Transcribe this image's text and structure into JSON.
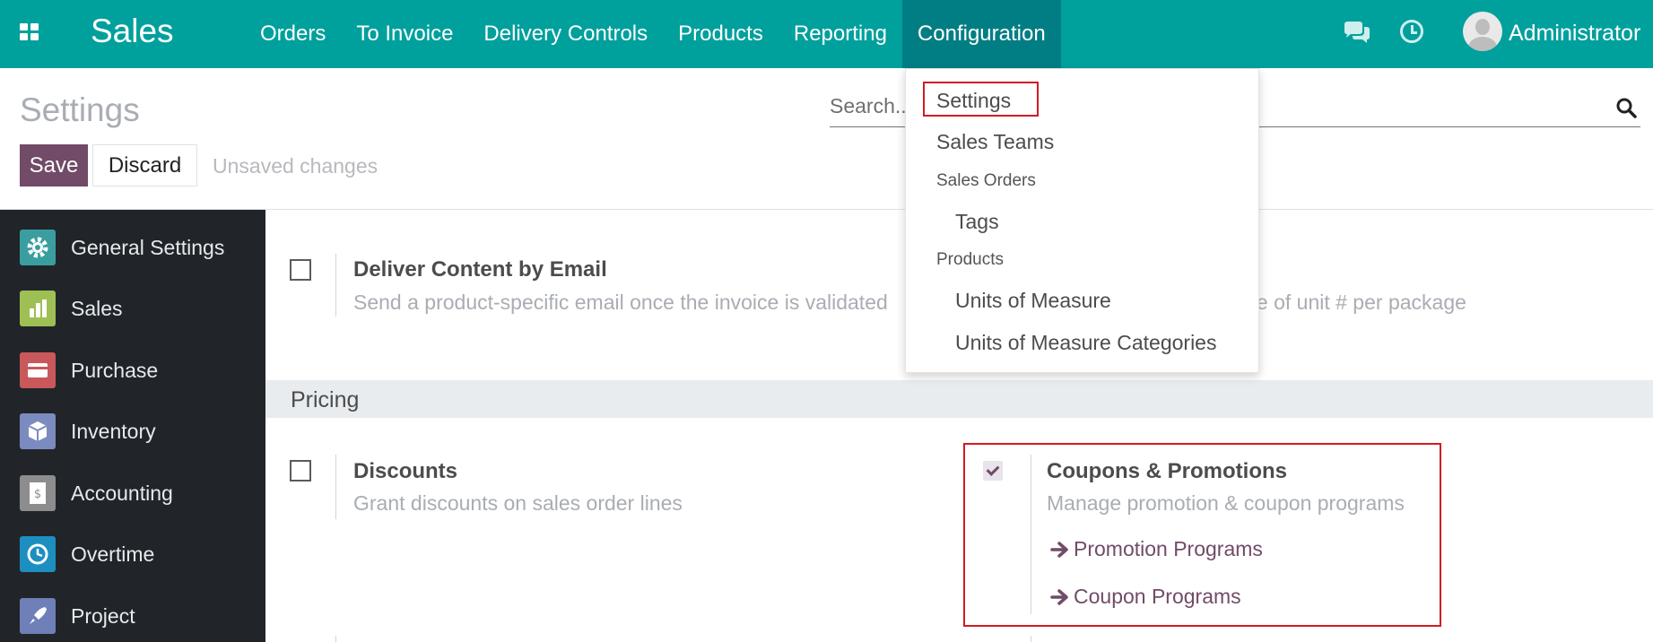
{
  "app": {
    "name": "Sales",
    "user": "Administrator"
  },
  "nav": {
    "menu": [
      {
        "label": "Orders"
      },
      {
        "label": "To Invoice"
      },
      {
        "label": "Delivery Controls"
      },
      {
        "label": "Products"
      },
      {
        "label": "Reporting"
      },
      {
        "label": "Configuration"
      }
    ],
    "active": "Configuration"
  },
  "control_panel": {
    "title": "Settings",
    "search_placeholder": "Search...",
    "save_label": "Save",
    "discard_label": "Discard",
    "status": "Unsaved changes"
  },
  "dropdown": {
    "items": [
      {
        "label": "Settings",
        "kind": "item"
      },
      {
        "label": "Sales Teams",
        "kind": "item"
      },
      {
        "label": "Sales Orders",
        "kind": "header"
      },
      {
        "label": "Tags",
        "kind": "subitem"
      },
      {
        "label": "Products",
        "kind": "header"
      },
      {
        "label": "Units of Measure",
        "kind": "subitem"
      },
      {
        "label": "Units of Measure Categories",
        "kind": "subitem"
      }
    ],
    "highlighted": "Settings"
  },
  "sidebar": {
    "items": [
      {
        "label": "General Settings",
        "icon": "gear-icon",
        "color": "#3a9ea0"
      },
      {
        "label": "Sales",
        "icon": "chart-icon",
        "color": "#9ebf53"
      },
      {
        "label": "Purchase",
        "icon": "card-icon",
        "color": "#c9585a"
      },
      {
        "label": "Inventory",
        "icon": "box-icon",
        "color": "#7b8bbf"
      },
      {
        "label": "Accounting",
        "icon": "document-icon",
        "color": "#8d8d8d"
      },
      {
        "label": "Overtime",
        "icon": "clock-icon",
        "color": "#1c8fc0"
      },
      {
        "label": "Project",
        "icon": "rocket-icon",
        "color": "#6f7fb8"
      }
    ],
    "active": "Sales"
  },
  "settings": {
    "deliver_content": {
      "title": "Deliver Content by Email",
      "desc_left": "Send a product-specific email once the invoice is validated",
      "desc_right": "ple of unit # per package",
      "checked": false
    },
    "section_pricing": "Pricing",
    "discounts": {
      "title": "Discounts",
      "desc": "Grant discounts on sales order lines",
      "checked": false
    },
    "coupons": {
      "title": "Coupons & Promotions",
      "desc": "Manage promotion & coupon programs",
      "checked": true,
      "links": [
        "Promotion Programs",
        "Coupon Programs"
      ]
    }
  },
  "colors": {
    "navbar": "#00a09d",
    "navbar_active": "#017e84",
    "primary": "#714b67",
    "highlight_box": "#d11c24",
    "sidebar_bg": "#212529"
  }
}
